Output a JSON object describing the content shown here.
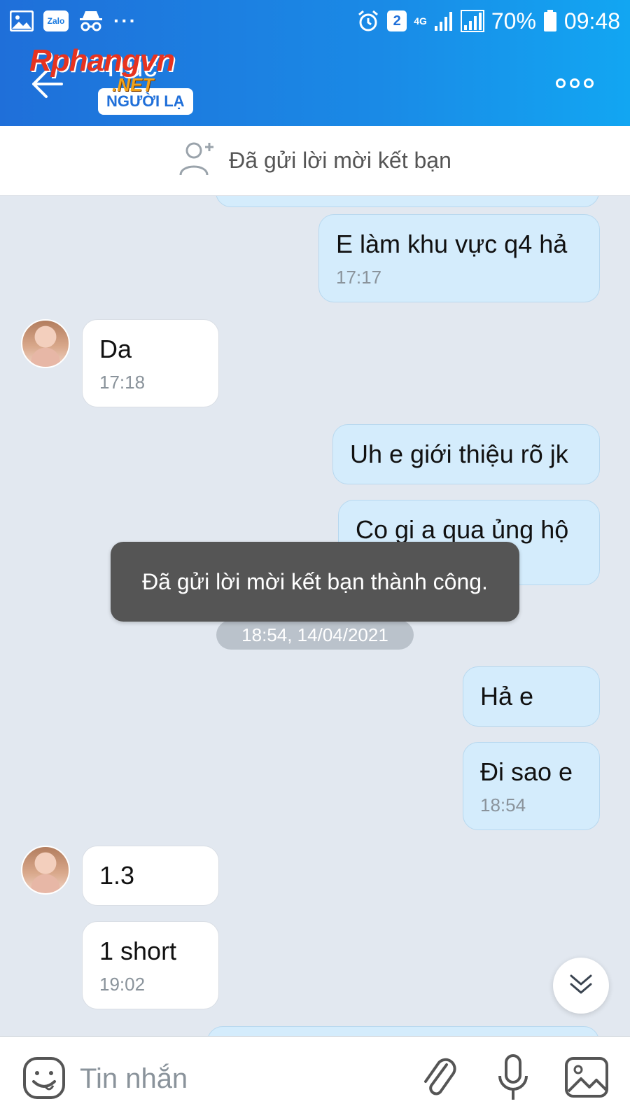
{
  "status_bar": {
    "app_icons": [
      "gallery-icon",
      "zalo-icon",
      "incognito-icon"
    ],
    "zalo_label": "Zalo",
    "overflow": "···",
    "notification_count": "2",
    "network": "4G",
    "battery": "70%",
    "time": "09:48"
  },
  "header": {
    "title": "Trúc",
    "tag": "NGƯỜI LẠ",
    "watermark": "Rphangvn",
    "watermark_sub": ".NET"
  },
  "friend_banner": {
    "text": "Đã gửi lời mời kết bạn"
  },
  "messages": [
    {
      "side": "sent",
      "text": "",
      "time": ""
    },
    {
      "side": "sent",
      "text": "E làm khu vực q4 hả",
      "time": "17:17"
    },
    {
      "side": "recv",
      "text": "Da",
      "time": "17:18"
    },
    {
      "side": "sent",
      "text": "Uh e giới thiệu rõ jk",
      "time": ""
    },
    {
      "side": "sent",
      "text": "Co gi a qua ủng hộ",
      "time": ""
    },
    {
      "side": "sent",
      "text": "Hả e",
      "time": ""
    },
    {
      "side": "sent",
      "text": "Đi sao e",
      "time": "18:54"
    },
    {
      "side": "recv",
      "text": "1.3",
      "time": ""
    },
    {
      "side": "recv",
      "text": "1 short",
      "time": "19:02"
    }
  ],
  "date_separator": "18:54, 14/04/2021",
  "toast": "Đã gửi lời mời kết bạn thành công.",
  "input": {
    "placeholder": "Tin nhắn"
  },
  "colors": {
    "header_start": "#1f6fd9",
    "header_end": "#12a6f2",
    "sent_bubble": "#d4ecfc",
    "recv_bubble": "#ffffff",
    "chat_background": "#e2e8f0",
    "toast": "#555555"
  }
}
